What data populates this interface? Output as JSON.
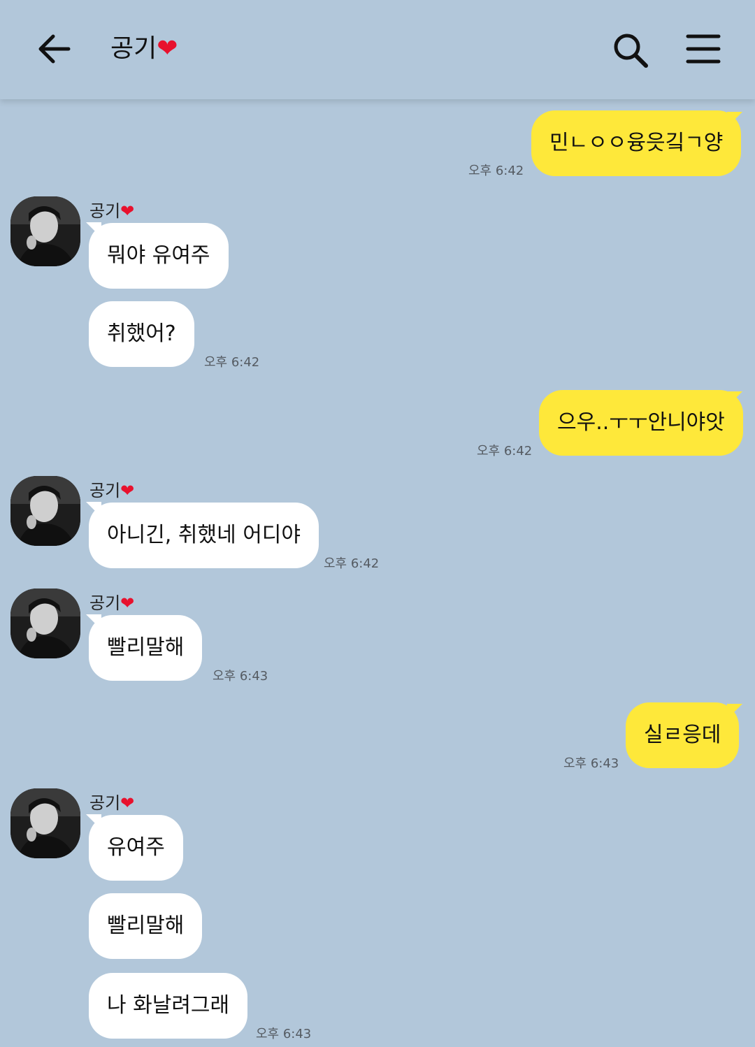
{
  "header": {
    "contact_name": "공기",
    "heart": "❤"
  },
  "messages": [
    {
      "dir": "out",
      "text": "민ㄴㅇㅇ융읏깈ㄱ양",
      "time": "오후 6:42"
    },
    {
      "dir": "in",
      "sender": "공기",
      "text": "뭐야 유여주"
    },
    {
      "dir": "in",
      "text": "취했어?",
      "time": "오후 6:42"
    },
    {
      "dir": "out",
      "text": "으우..ㅜㅜ안니야앗",
      "time": "오후 6:42"
    },
    {
      "dir": "in",
      "sender": "공기",
      "text": "아니긴, 취했네 어디야",
      "time": "오후 6:42"
    },
    {
      "dir": "in",
      "sender": "공기",
      "text": "빨리말해",
      "time": "오후 6:43"
    },
    {
      "dir": "out",
      "text": "실ㄹ응데",
      "time": "오후 6:43"
    },
    {
      "dir": "in",
      "sender": "공기",
      "text": "유여주"
    },
    {
      "dir": "in",
      "text": "빨리말해"
    },
    {
      "dir": "in",
      "text": "나 화날려그래",
      "time": "오후 6:43"
    }
  ],
  "colors": {
    "background": "#b2c7da",
    "outgoing_bubble": "#fee83a",
    "incoming_bubble": "#ffffff",
    "heart": "#e8112d"
  },
  "icons": {
    "back": "arrow-left-icon",
    "search": "search-icon",
    "menu": "hamburger-menu-icon",
    "avatar": "profile-photo"
  }
}
